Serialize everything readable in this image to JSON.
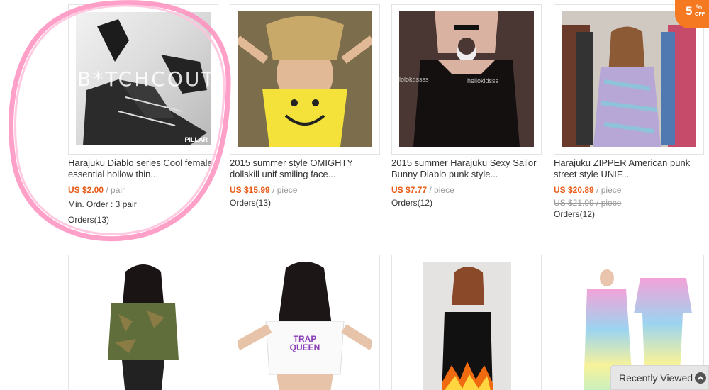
{
  "products": [
    {
      "title": "Harajuku Diablo series Cool female essential hollow thin...",
      "price": "US $2.00",
      "unit": "/ pair",
      "min_order": "Min. Order : 3 pair",
      "orders": "Orders(13)",
      "watermark": "B*TCHCOUTURE",
      "corner_mark": "PILLAR"
    },
    {
      "title": "2015 summer style OMIGHTY dollskill unif smiling face...",
      "price": "US $15.99",
      "unit": "/ piece",
      "orders": "Orders(13)"
    },
    {
      "title": "2015 summer Harajuku Sexy Sailor Bunny Diablo punk style...",
      "price": "US $7.77",
      "unit": "/ piece",
      "orders": "Orders(12)",
      "watermark_left": "lolokdssss",
      "watermark_right": "hellokidsss"
    },
    {
      "title": "Harajuku ZIPPER American punk street style UNIF...",
      "price": "US $20.89",
      "unit": "/ piece",
      "old_price": "US $21.99 / piece",
      "orders": "Orders(12)"
    },
    {
      "image": "green camo long-sleeve crop top"
    },
    {
      "image": "white crop tee with TRAP QUEEN print",
      "print_text": "TRAP QUEEN"
    },
    {
      "image": "black halter top with flame print"
    },
    {
      "image": "pastel tie-dye kimono and dress"
    }
  ],
  "badge": {
    "number": "5",
    "percent": "%",
    "off": "OFF"
  },
  "recently_viewed": {
    "label": "Recently Viewed"
  },
  "colors": {
    "price": "#e85a15",
    "highlight": "#ff8fc0",
    "badge": "#f47920"
  }
}
